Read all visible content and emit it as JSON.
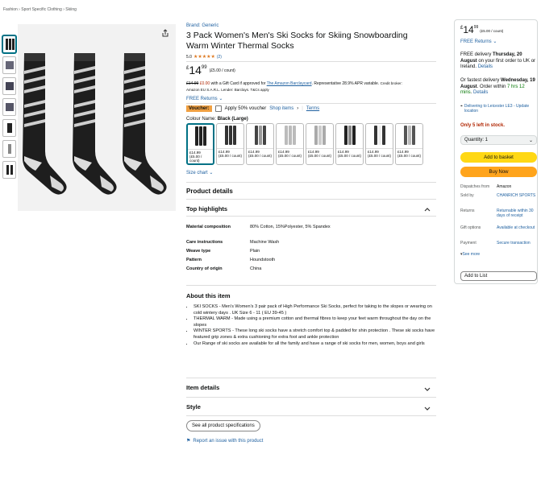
{
  "breadcrumb": [
    "Fashion",
    "Sport Specific Clothing",
    "Skiing"
  ],
  "brand": "Brand: Generic",
  "title": "3 Pack Women's Men's Ski Socks for Skiing Snowboarding Warm Winter Thermal Socks",
  "rating": {
    "value": "5.0",
    "stars": "★★★★★",
    "count": "(2)"
  },
  "price": {
    "currency": "£",
    "whole": "14",
    "fraction": "99",
    "per_unit": "(£5.00 / count)"
  },
  "rrp_line": {
    "old": "£14.99",
    "new": "£0.00",
    "text": " with a Gift Card if approved for ",
    "link": "The Amazon Barclaycard",
    "tail": ". Representative 28.9% APR variable.",
    "credit": "Credit broker:",
    "credit2": "Amazon EU S.A.R.L. Lender: Barclays. T&Cs apply"
  },
  "free_returns": "FREE Returns",
  "voucher": {
    "badge": "Voucher:",
    "text": "Apply 50% voucher",
    "shop": "Shop items",
    "terms": "Terms"
  },
  "colour": {
    "label": "Colour Name:",
    "value": "Black (Large)"
  },
  "swatches": [
    {
      "price": "£14.99",
      "per": "(£5.00 / count)",
      "colors": [
        "#222",
        "#222",
        "#222"
      ]
    },
    {
      "price": "£14.99",
      "per": "(£5.00 / count)",
      "colors": [
        "#333",
        "#333",
        "#333"
      ]
    },
    {
      "price": "£14.99",
      "per": "(£5.00 / count)",
      "colors": [
        "#444",
        "#999",
        "#444"
      ]
    },
    {
      "price": "£14.99",
      "per": "(£5.00 / count)",
      "colors": [
        "#bbb",
        "#bbb",
        "#bbb"
      ]
    },
    {
      "price": "£14.99",
      "per": "(£5.00 / count)",
      "colors": [
        "#aaa",
        "#ccc",
        "#aaa"
      ]
    },
    {
      "price": "£14.99",
      "per": "(£5.00 / count)",
      "colors": [
        "#222",
        "#888",
        "#222"
      ]
    },
    {
      "price": "£14.99",
      "per": "(£5.00 / count)",
      "colors": [
        "#333",
        "#eee",
        "#333"
      ]
    },
    {
      "price": "£14.99",
      "per": "(£5.00 / count)",
      "colors": [
        "#555",
        "#bbb",
        "#555"
      ]
    }
  ],
  "size_chart": "Size chart",
  "product_details": "Product details",
  "top_highlights": "Top highlights",
  "specs": [
    {
      "k": "Material composition",
      "v": "80% Cotton, 15%Polyester, 5% Spandex"
    },
    {
      "k": "Care instructions",
      "v": "Machine Wash"
    },
    {
      "k": "Weave type",
      "v": "Plain"
    },
    {
      "k": "Pattern",
      "v": "Houndstooth"
    },
    {
      "k": "Country of origin",
      "v": "China"
    }
  ],
  "about_title": "About this item",
  "about": [
    "SKI SOCKS - Men's Women's 3 pair pack of High Performance Ski Socks, perfect for taking to the slopes or wearing on cold wintery days . UK Size 6 - 11 ( EU 39-45 )",
    "THERMAL WARM - Made using a premium cotton and thermal fibres to keep your feet warm throughout the day on the slopes",
    "WINTER SPORTS - These long ski socks have a stretch comfort top & padded for shin protection . These ski socks have featured grip zones & extra cushioning for extra foot and ankle protection",
    "Our Range of ski socks are available for all the family and have a range of ski socks for men, women, boys and girls"
  ],
  "item_details": "Item details",
  "style": "Style",
  "see_all": "See all product specifications",
  "report": "Report an issue with this product",
  "buybox": {
    "whole": "14",
    "fraction": "99",
    "per": "(£5.00 / count)",
    "free_returns": "FREE Returns",
    "delivery1": "FREE delivery ",
    "delivery1b": "Thursday, 20 August",
    "delivery1c": " on your first order to UK or Ireland. ",
    "details": "Details",
    "delivery2": "Or fastest delivery ",
    "delivery2b": "Wednesday, 19 August",
    "delivery2c": ". Order within ",
    "delivery2d": "7 hrs 12 mins",
    "location": "Delivering to Leicester LE3 - Update location",
    "stock": "Only 5 left in stock.",
    "qty": "Quantity: 1",
    "add": "Add to basket",
    "buy": "Buy Now",
    "rows": [
      {
        "k": "Dispatches from",
        "v": "Amazon",
        "plain": true
      },
      {
        "k": "Sold by",
        "v": "CHANRICH SPORTS"
      },
      {
        "k": "Returns",
        "v": "Returnable within 30 days of receipt"
      },
      {
        "k": "Gift options",
        "v": "Available at checkout"
      },
      {
        "k": "Payment",
        "v": "Secure transaction"
      }
    ],
    "see_more": "See more",
    "add_list": "Add to List"
  }
}
